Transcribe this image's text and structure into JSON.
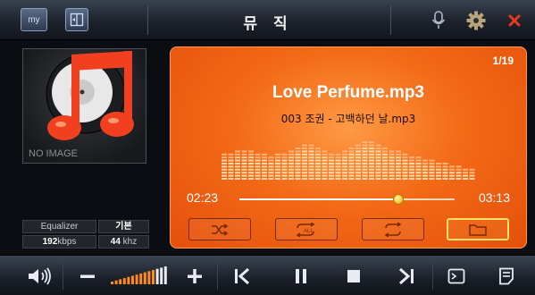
{
  "header": {
    "title": "뮤 직",
    "my_label": "my",
    "icons": [
      "exit-icon",
      "microphone-icon",
      "gear-icon",
      "close-icon"
    ]
  },
  "album": {
    "placeholder": "NO IMAGE"
  },
  "audio_info": {
    "equalizer_label": "Equalizer",
    "equalizer_value": "기본",
    "bitrate_value": "192",
    "bitrate_unit": "kbps",
    "sample_rate_value": "44",
    "sample_rate_unit": "khz"
  },
  "player": {
    "track_position": "1/19",
    "song_title": "Love Perfume.mp3",
    "file_name": "003 조권 - 고백하던 날.mp3",
    "elapsed": "02:23",
    "total": "03:13",
    "progress": 0.74,
    "buttons": [
      "shuffle-icon",
      "repeat-all-icon",
      "repeat-one-icon",
      "folder-icon"
    ],
    "active_button": "folder-icon"
  },
  "toolbar": {
    "volume_level": 0.85,
    "icons": [
      "speaker-icon",
      "volume-down-icon",
      "volume-up-icon",
      "previous-icon",
      "pause-icon",
      "stop-icon",
      "next-icon",
      "screen-icon",
      "list-icon"
    ]
  },
  "colors": {
    "accent": "#f36a17",
    "close": "#e83a1a",
    "knob": "#f2b400"
  }
}
